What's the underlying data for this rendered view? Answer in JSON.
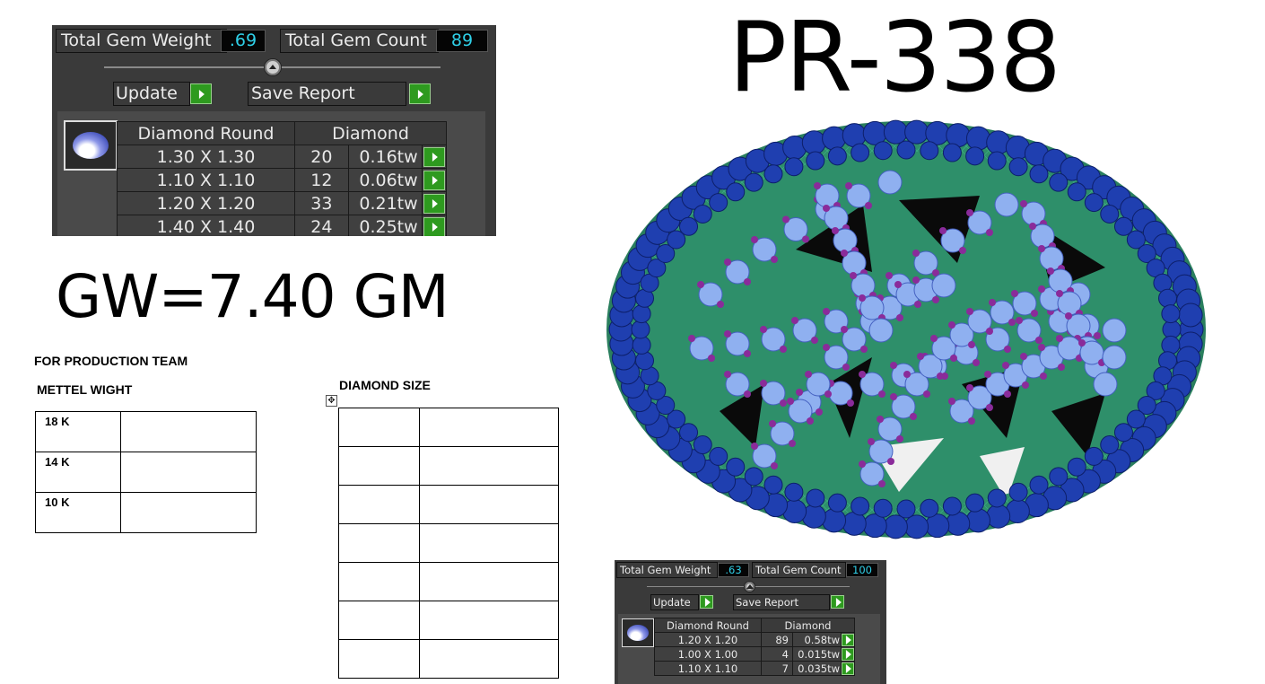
{
  "title": "PR-338",
  "gross_weight": "GW=7.40 GM",
  "production": {
    "heading": "FOR PRODUCTION TEAM",
    "metal_heading": "METTEL WIGHT",
    "metal_rows": [
      {
        "karat": "18 K",
        "value": ""
      },
      {
        "karat": "14 K",
        "value": ""
      },
      {
        "karat": "10 K",
        "value": ""
      }
    ],
    "diamond_heading": "DIAMOND SIZE",
    "diamond_rows": 7
  },
  "panel_a": {
    "weight_label": "Total Gem Weight",
    "weight_value": ".69",
    "count_label": "Total Gem Count",
    "count_value": "89",
    "update_label": "Update",
    "save_label": "Save Report",
    "col_shape": "Diamond Round",
    "col_type": "Diamond",
    "rows": [
      {
        "size": "1.30 X 1.30",
        "count": "20",
        "weight": "0.16tw"
      },
      {
        "size": "1.10 X 1.10",
        "count": "12",
        "weight": "0.06tw"
      },
      {
        "size": "1.20 X 1.20",
        "count": "33",
        "weight": "0.21tw"
      },
      {
        "size": "1.40 X 1.40",
        "count": "24",
        "weight": "0.25tw"
      }
    ]
  },
  "panel_b": {
    "weight_label": "Total Gem Weight",
    "weight_value": ".63",
    "count_label": "Total Gem Count",
    "count_value": "100",
    "update_label": "Update",
    "save_label": "Save Report",
    "col_shape": "Diamond Round",
    "col_type": "Diamond",
    "rows": [
      {
        "size": "1.20 X 1.20",
        "count": "89",
        "weight": "0.58tw"
      },
      {
        "size": "1.00 X 1.00",
        "count": "4",
        "weight": "0.015tw"
      },
      {
        "size": "1.10 X 1.10",
        "count": "7",
        "weight": "0.035tw"
      }
    ]
  },
  "colors": {
    "panel_bg": "#3a3a3a",
    "value_text": "#2fd0e8",
    "play_green": "#2e9a1f",
    "ring_metal": "#2e8f6a",
    "ring_blue": "#1f3fb0",
    "stone_light": "#8fb0f0",
    "prong_purple": "#8a2b9a"
  }
}
